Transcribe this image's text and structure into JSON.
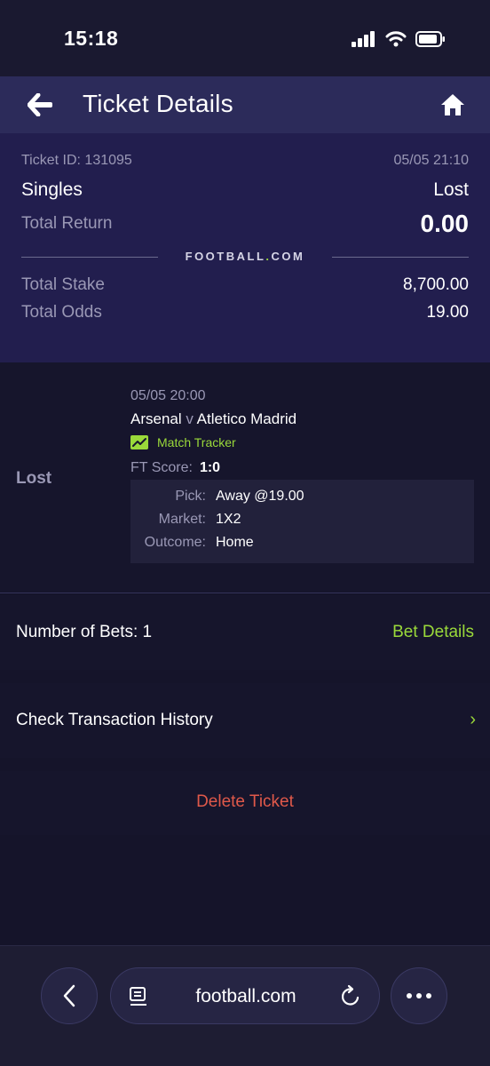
{
  "status_bar": {
    "time": "15:18"
  },
  "header": {
    "title": "Ticket Details"
  },
  "summary": {
    "ticket_id": "Ticket ID: 131095",
    "datetime": "05/05 21:10",
    "type": "Singles",
    "status": "Lost",
    "total_return_label": "Total Return",
    "total_return": "0.00",
    "brand_pre": "FOOTBALL",
    "brand_dot": ".",
    "brand_post": "COM",
    "total_stake_label": "Total Stake",
    "total_stake": "8,700.00",
    "total_odds_label": "Total Odds",
    "total_odds": "19.00"
  },
  "bet": {
    "status": "Lost",
    "date": "05/05 20:00",
    "home_team": "Arsenal",
    "vs": "v",
    "away_team": "Atletico Madrid",
    "tracker_label": "Match Tracker",
    "ft_label": "FT Score:",
    "ft_score": "1:0",
    "pick_label": "Pick:",
    "pick": "Away @19.00",
    "market_label": "Market:",
    "market": "1X2",
    "outcome_label": "Outcome:",
    "outcome": "Home"
  },
  "sections": {
    "number_of_bets": "Number of Bets: 1",
    "bet_details": "Bet Details",
    "transaction_history": "Check Transaction History",
    "chevron": "›",
    "delete": "Delete Ticket"
  },
  "browser": {
    "url": "football.com"
  },
  "colors": {
    "accent_green": "#9ad93a",
    "delete_red": "#e0594a",
    "header_bg": "#2c2b5a",
    "summary_bg": "#221e4e"
  },
  "icons": [
    "back-arrow-icon",
    "home-icon",
    "match-tracker-icon",
    "reader-icon",
    "reload-icon",
    "browser-back-icon",
    "more-icon",
    "signal-icon",
    "wifi-icon",
    "battery-icon"
  ]
}
